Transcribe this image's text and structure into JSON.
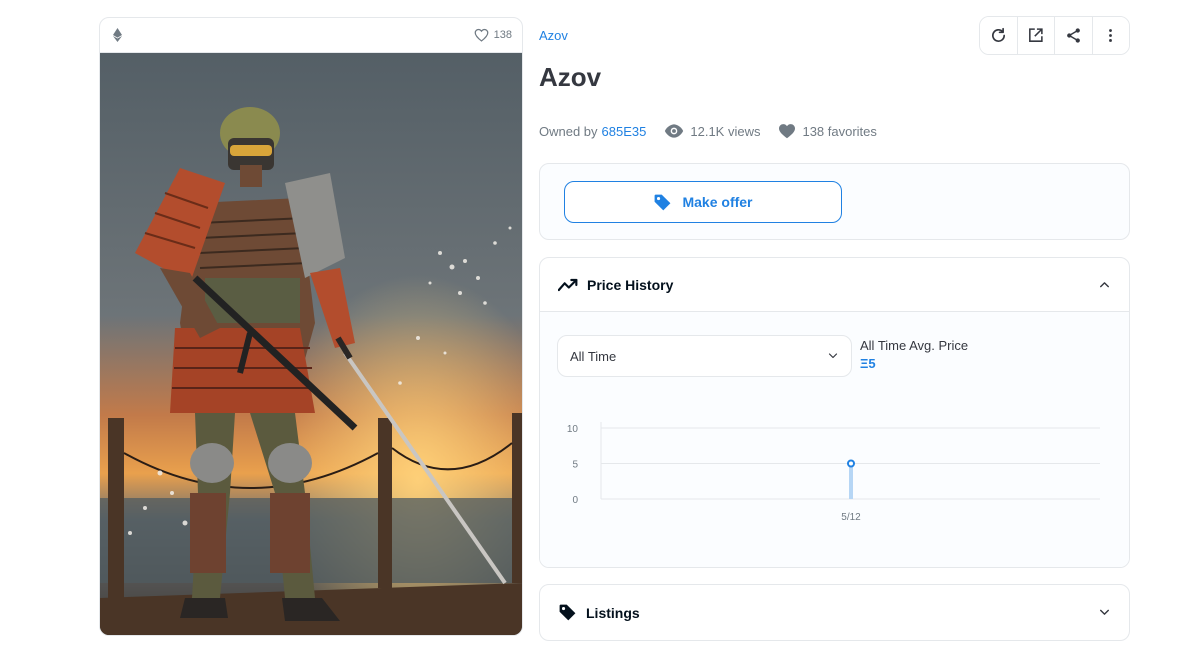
{
  "media": {
    "favorites_count": "138"
  },
  "item": {
    "collection_name": "Azov",
    "title": "Azov",
    "owned_by_label": "Owned by",
    "owner": "685E35",
    "views": "12.1K views",
    "favorites": "138 favorites"
  },
  "toolbar": {
    "icons": [
      "refresh-icon",
      "external-link-icon",
      "share-icon",
      "more-vertical-icon"
    ]
  },
  "offer": {
    "button_label": "Make offer"
  },
  "price_history": {
    "heading": "Price History",
    "period_selected": "All Time",
    "avg_label": "All Time Avg. Price",
    "avg_value": "Ξ5"
  },
  "chart_data": {
    "type": "line",
    "x": [
      "5/12"
    ],
    "series": [
      {
        "values": [
          5
        ]
      }
    ],
    "yticks": [
      0,
      5,
      10
    ],
    "ylim": [
      0,
      10
    ],
    "grid": true
  },
  "listings": {
    "heading": "Listings"
  },
  "colors": {
    "accent": "#2081e2",
    "text": "#353840",
    "muted": "#707a83",
    "border": "#e5e8eb"
  }
}
